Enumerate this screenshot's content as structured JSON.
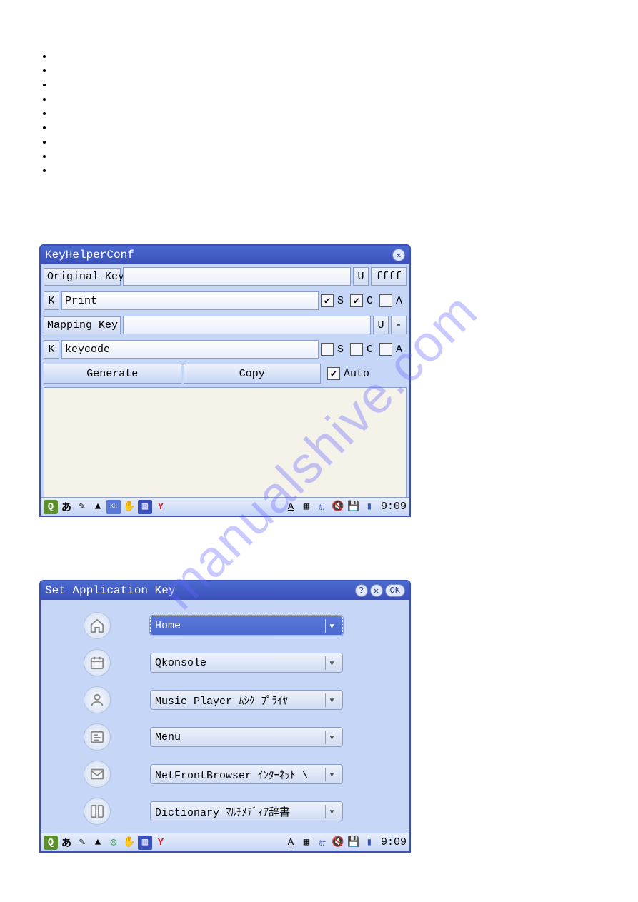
{
  "watermark": "manualshive.com",
  "bullets_count": 9,
  "win1": {
    "title": "KeyHelperConf",
    "original_key_label": "Original Key",
    "original_key_value": "",
    "u_label": "U",
    "ffff_value": "ffff",
    "k_label": "K",
    "k1_value": "Print",
    "s_label": "S",
    "c_label": "C",
    "a_label": "A",
    "row1_s_checked": true,
    "row1_c_checked": true,
    "row1_a_checked": false,
    "mapping_key_label": "Mapping Key",
    "mapping_key_value": "",
    "mapping_dash": "-",
    "k2_value": "keycode",
    "row2_s_checked": false,
    "row2_c_checked": false,
    "row2_a_checked": false,
    "generate_btn": "Generate",
    "copy_btn": "Copy",
    "auto_checked": true,
    "auto_label": "Auto"
  },
  "win2": {
    "title": "Set Application Key",
    "ok_label": "OK",
    "rows": [
      {
        "icon": "home",
        "value": "Home",
        "focused": true
      },
      {
        "icon": "calendar",
        "value": "Qkonsole",
        "focused": false
      },
      {
        "icon": "user",
        "value": "Music Player ﾑｼｸ ﾌﾟﾗｲﾔ",
        "focused": false
      },
      {
        "icon": "menu",
        "value": "Menu",
        "focused": false
      },
      {
        "icon": "mail",
        "value": "NetFrontBrowser ｲﾝﾀｰﾈｯﾄ \\",
        "focused": false
      },
      {
        "icon": "book",
        "value": "Dictionary ﾏﾙﾁﾒﾃﾞｨｱ辞書",
        "focused": false
      }
    ]
  },
  "taskbar": {
    "ime": "あ",
    "clock": "9:09"
  }
}
